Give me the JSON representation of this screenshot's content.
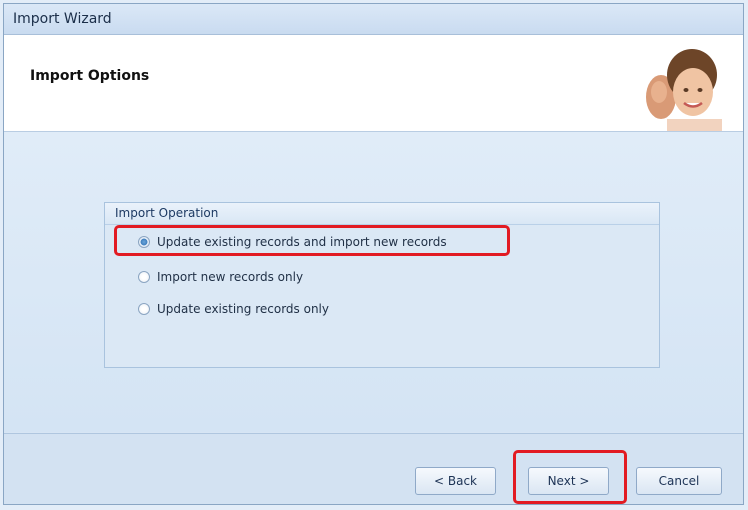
{
  "window": {
    "title": "Import Wizard"
  },
  "header": {
    "title": "Import Options"
  },
  "group": {
    "title": "Import Operation",
    "options": [
      {
        "label": "Update existing records and import new records",
        "selected": true
      },
      {
        "label": "Import new records only",
        "selected": false
      },
      {
        "label": "Update existing records only",
        "selected": false
      }
    ]
  },
  "footer": {
    "back_label": "< Back",
    "next_label": "Next >",
    "cancel_label": "Cancel"
  },
  "colors": {
    "highlight": "#e21b23",
    "accent": "#3f7fbe"
  },
  "icons": {
    "header_image": "people-photo-icon"
  }
}
